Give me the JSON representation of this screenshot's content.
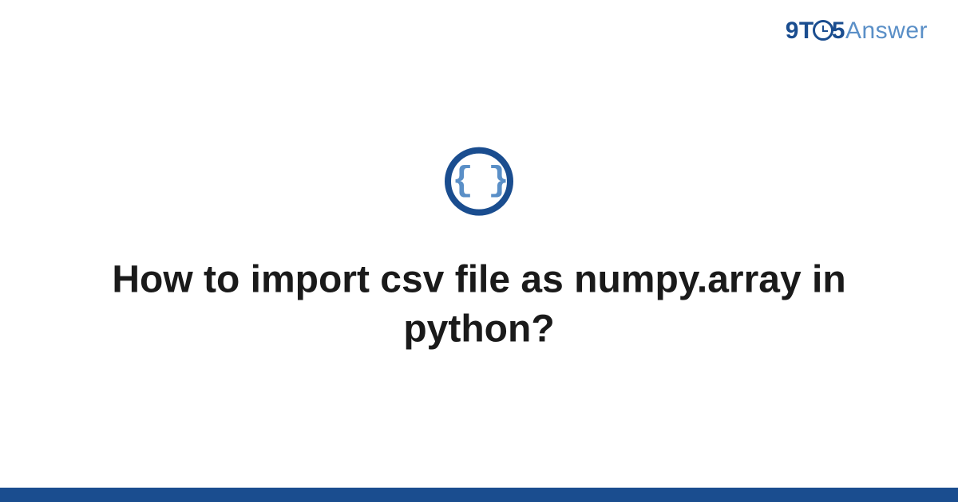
{
  "logo": {
    "part1": "9T",
    "part2": "5",
    "part3": "Answer",
    "icon_name": "clock-icon"
  },
  "center_icon": {
    "name": "code-braces-icon",
    "glyph": "{ }"
  },
  "question": {
    "title": "How to import csv file as numpy.array in python?"
  },
  "colors": {
    "primary_dark": "#1a4d8f",
    "primary_light": "#5a8fc7",
    "text": "#1a1a1a"
  }
}
